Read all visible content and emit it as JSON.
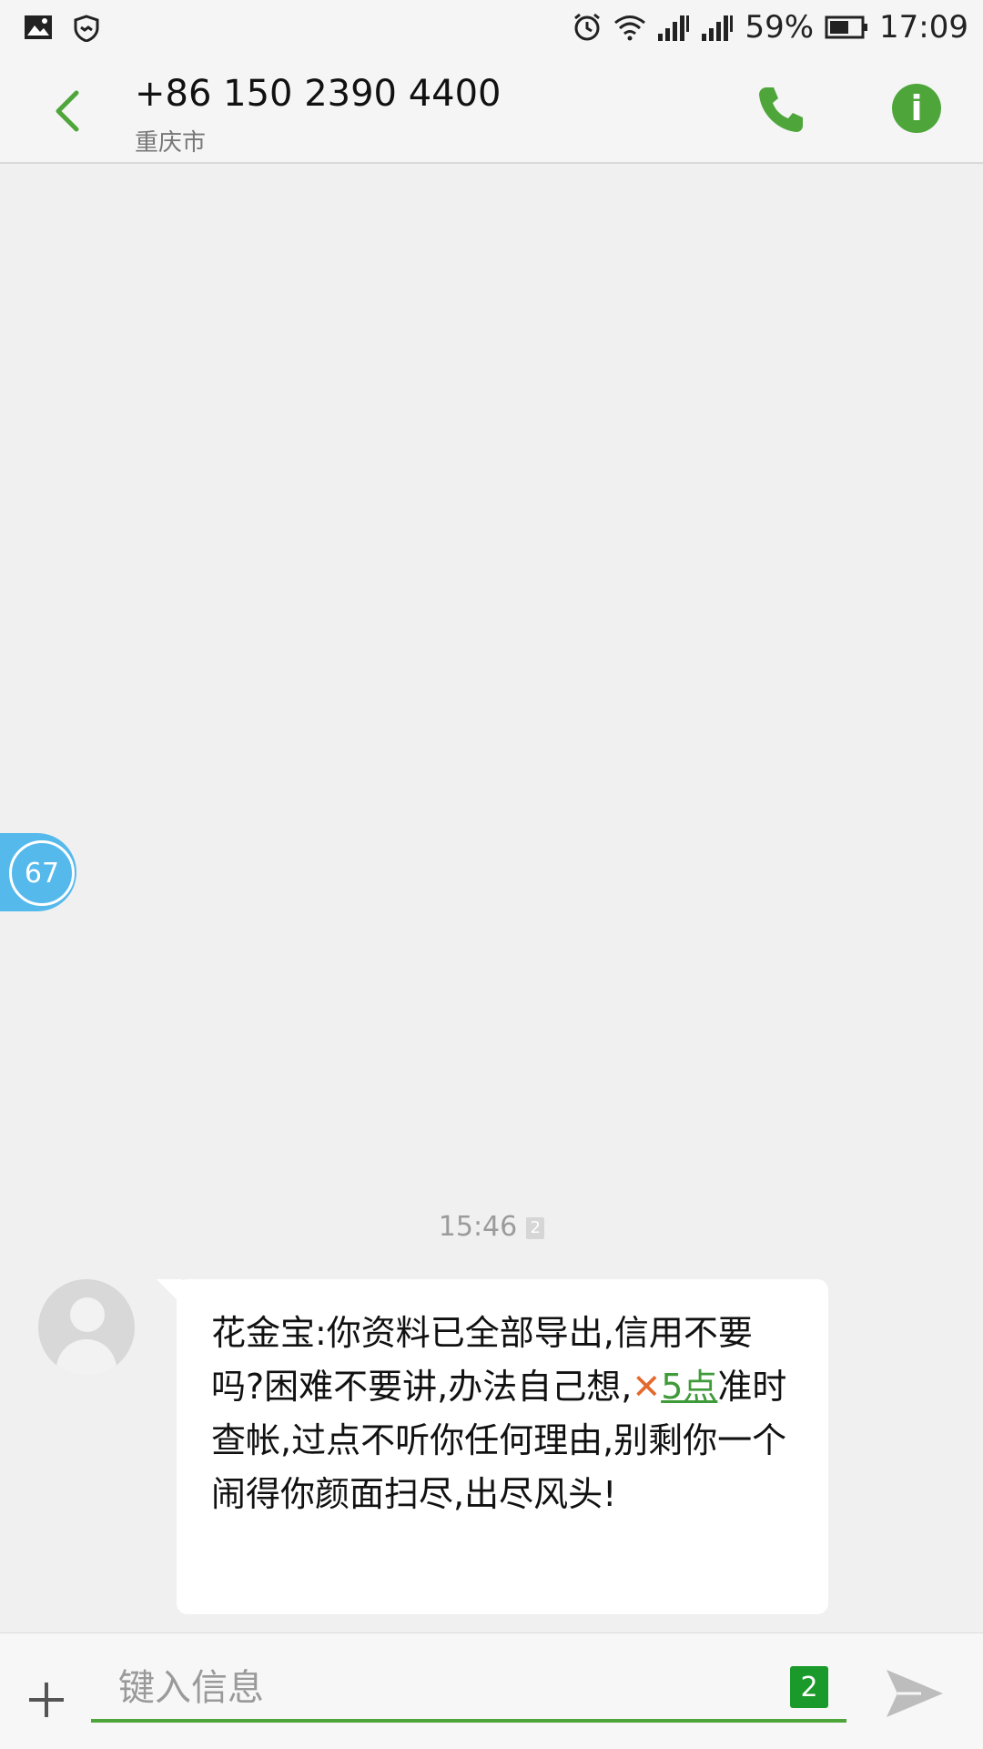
{
  "status_bar": {
    "battery": "59%",
    "time": "17:09"
  },
  "header": {
    "title": "+86 150 2390 4400",
    "subtitle": "重庆市"
  },
  "floating_badge": {
    "count": "67"
  },
  "message": {
    "timestamp": "15:46",
    "sim_label": "2",
    "text_part1": "花金宝:你资料已全部导出,信用不要吗?困难不要讲,办法自己想,",
    "icon_x": "✕",
    "link_text": "5点",
    "text_part2": "准时查帐,过点不听你任何理由,别剩你一个闹得你颜面扫尽,出尽风头!"
  },
  "composer": {
    "placeholder": "键入信息",
    "sim_badge": "2"
  },
  "colors": {
    "accent": "#4ea63b",
    "badge_blue": "#55b9ec",
    "x_orange": "#e36a2c"
  }
}
